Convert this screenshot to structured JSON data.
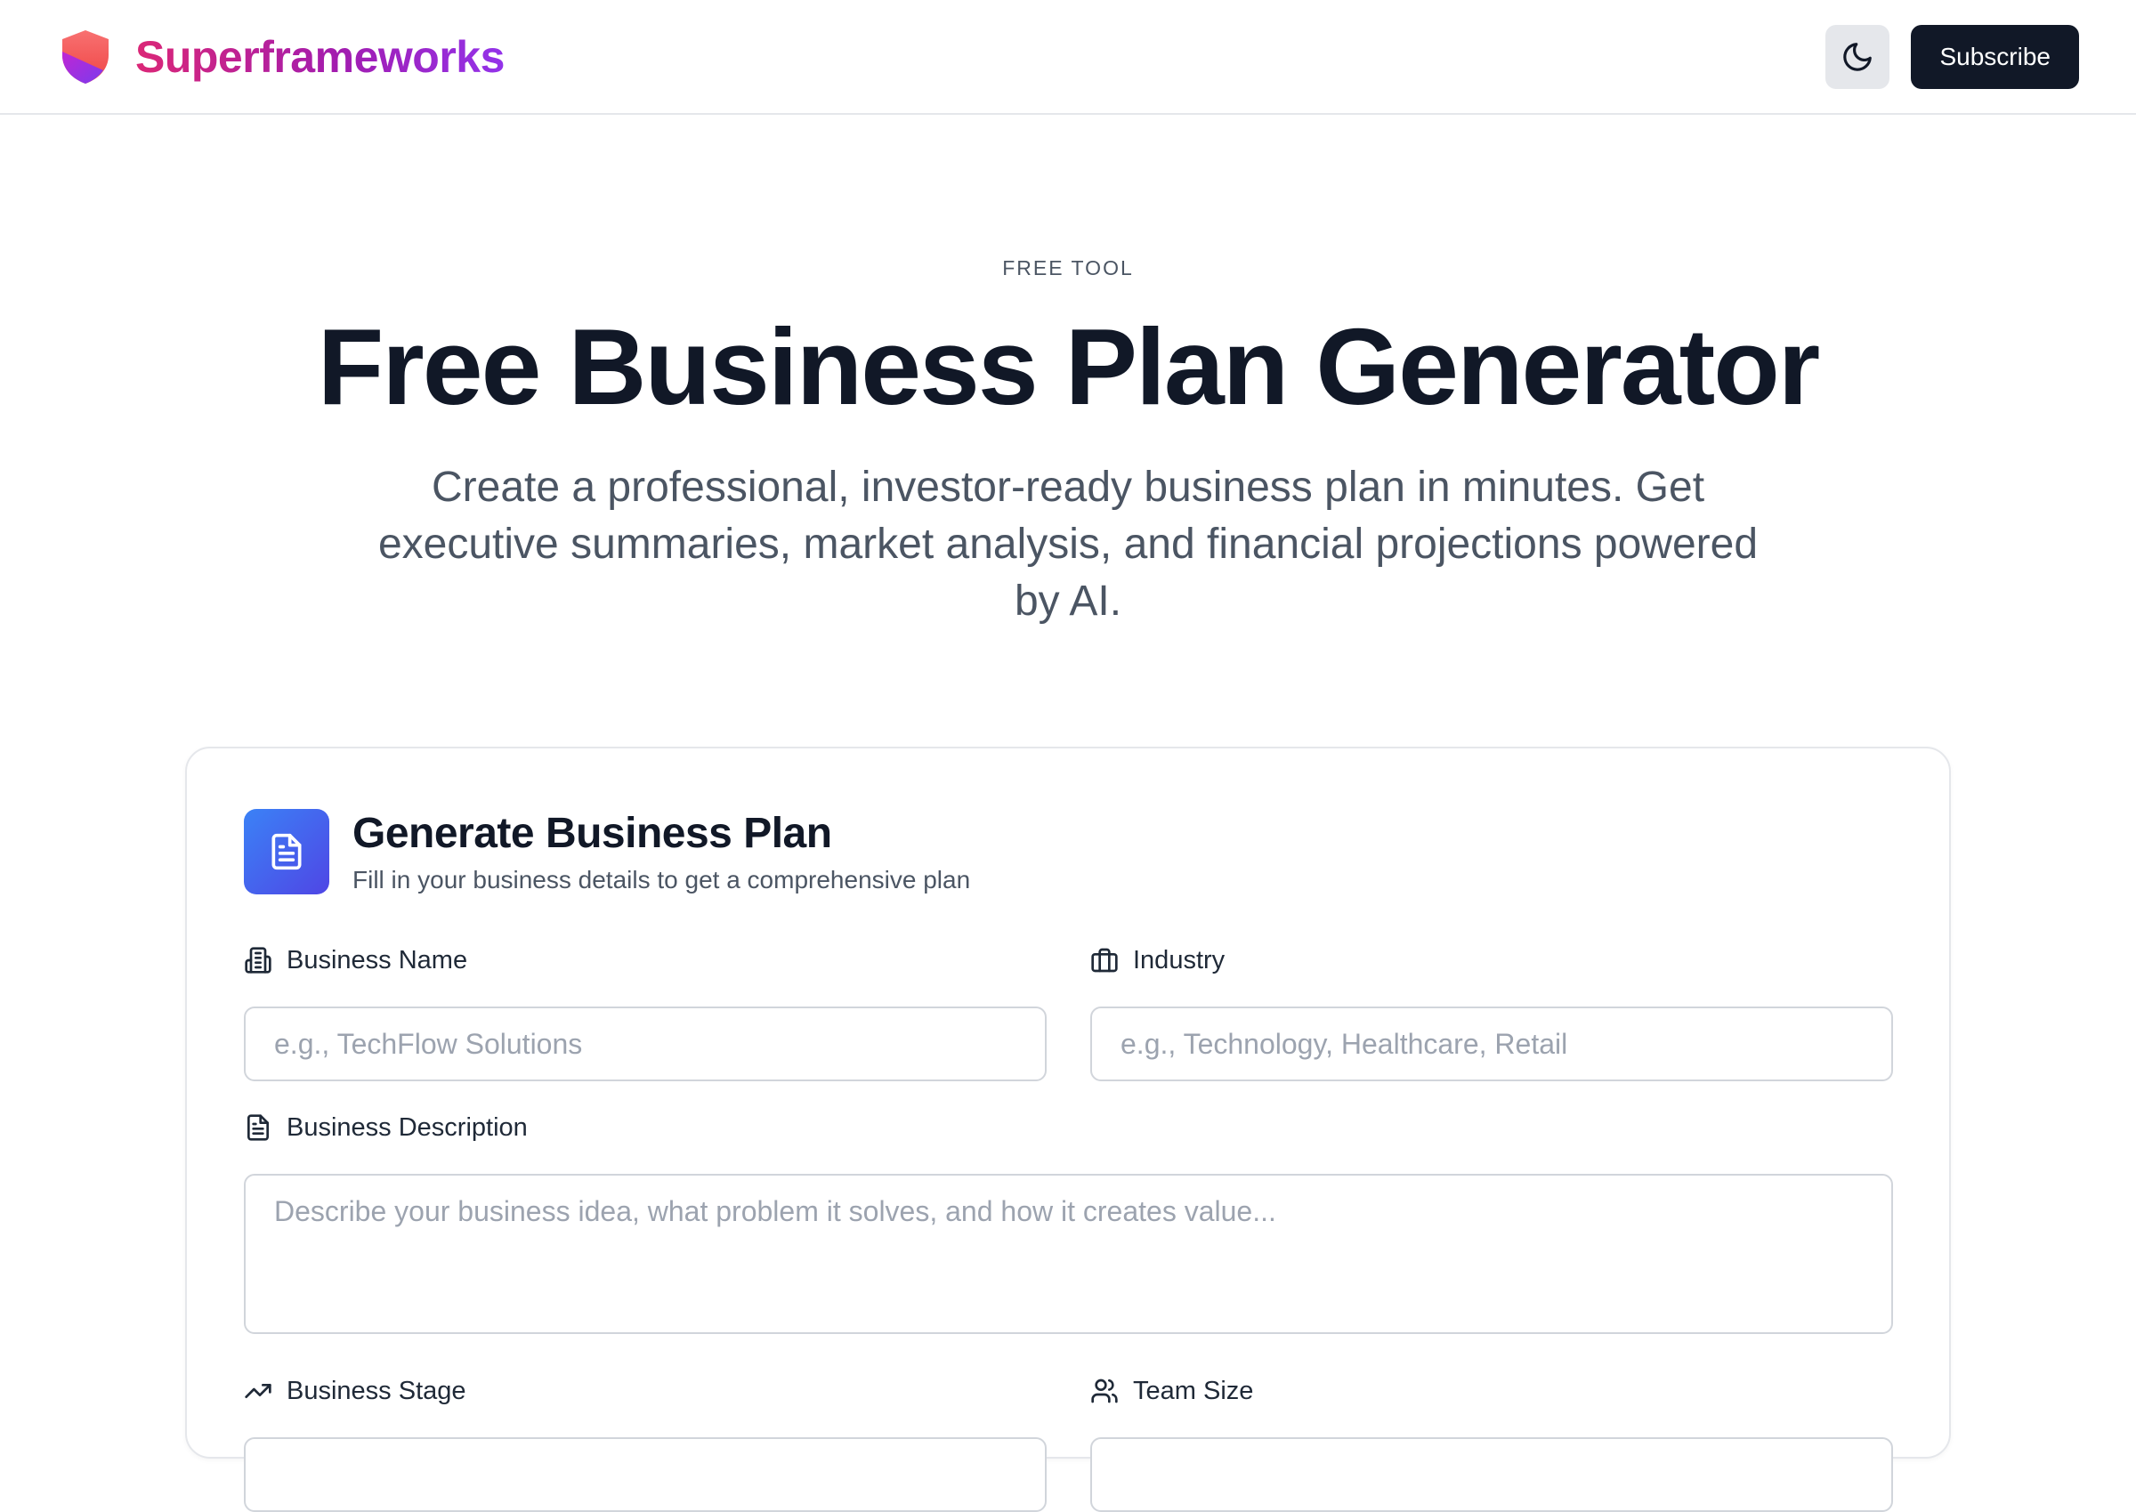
{
  "header": {
    "brand_name": "Superframeworks",
    "subscribe_label": "Subscribe",
    "logo_icon": "shield-icon",
    "theme_icon": "moon-icon"
  },
  "hero": {
    "eyebrow": "FREE TOOL",
    "title": "Free Business Plan Generator",
    "subtitle": "Create a professional, investor-ready business plan in minutes. Get executive summaries, market analysis, and financial projections powered by AI."
  },
  "card": {
    "title": "Generate Business Plan",
    "subtitle": "Fill in your business details to get a comprehensive plan",
    "icon": "document-icon",
    "fields": {
      "business_name": {
        "label": "Business Name",
        "placeholder": "e.g., TechFlow Solutions",
        "icon": "building-icon"
      },
      "industry": {
        "label": "Industry",
        "placeholder": "e.g., Technology, Healthcare, Retail",
        "icon": "briefcase-icon"
      },
      "description": {
        "label": "Business Description",
        "placeholder": "Describe your business idea, what problem it solves, and how it creates value...",
        "icon": "document-icon"
      },
      "stage": {
        "label": "Business Stage",
        "icon": "trending-up-icon"
      },
      "team_size": {
        "label": "Team Size",
        "icon": "users-icon"
      }
    }
  },
  "colors": {
    "brand_gradient_start": "#db2777",
    "brand_gradient_end": "#9333ea",
    "primary_dark": "#111827",
    "card_icon_start": "#3b82f6",
    "card_icon_end": "#4f46e5"
  }
}
